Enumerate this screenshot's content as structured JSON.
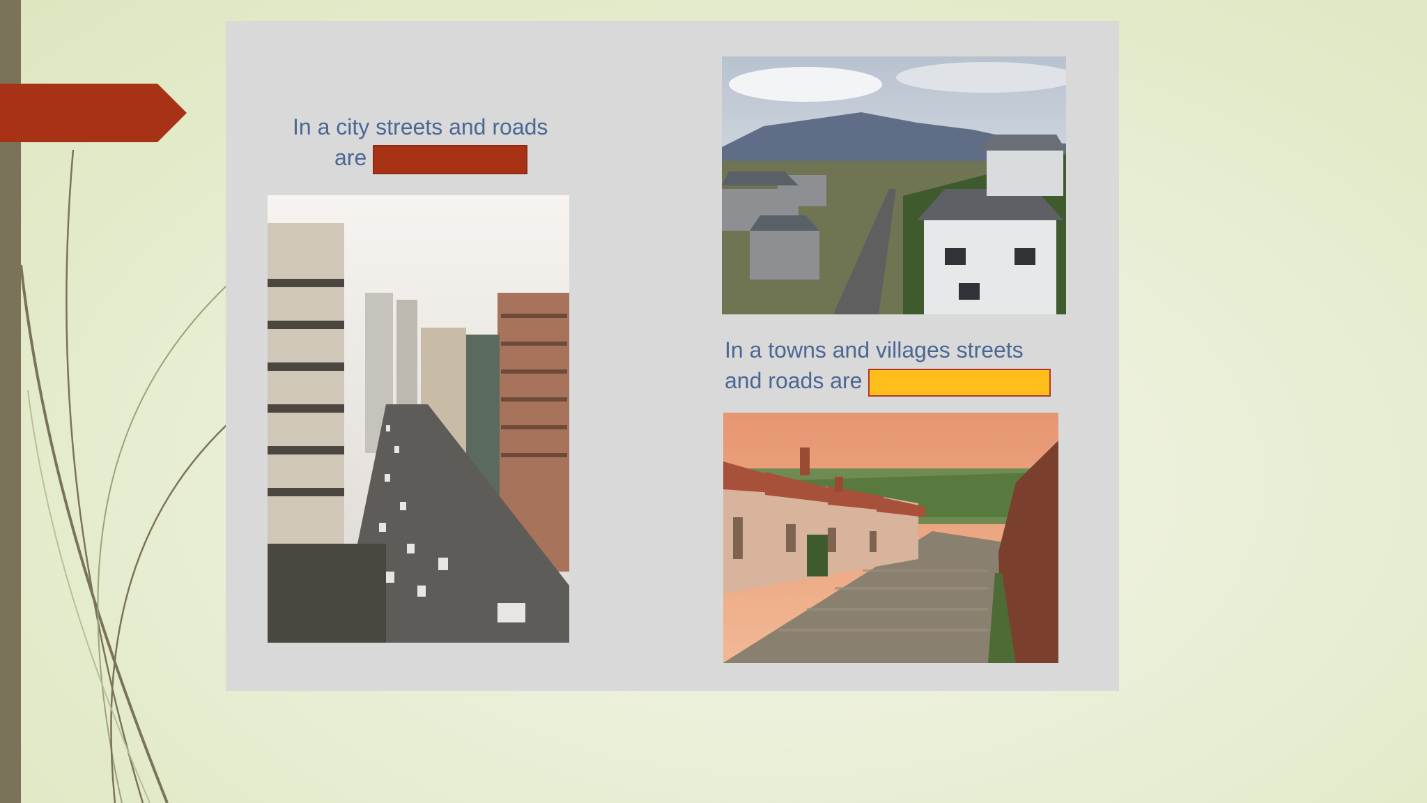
{
  "slide": {
    "caption_city": {
      "line1": "In a city streets and roads",
      "line2": "are"
    },
    "caption_towns": {
      "line1": "In a towns and villages streets",
      "line2": "and roads are"
    },
    "colors": {
      "accent_arrow": "#a83216",
      "blank_city": "#a83216",
      "blank_towns": "#fdbd1a",
      "caption_text": "#4c6793",
      "panel": "#d9d9d9",
      "left_bar": "#7b7359"
    },
    "images": {
      "city": "busy-city-avenue-photo",
      "suburb": "suburban-street-houses-photo",
      "village": "village-cobblestone-hill-photo"
    }
  }
}
